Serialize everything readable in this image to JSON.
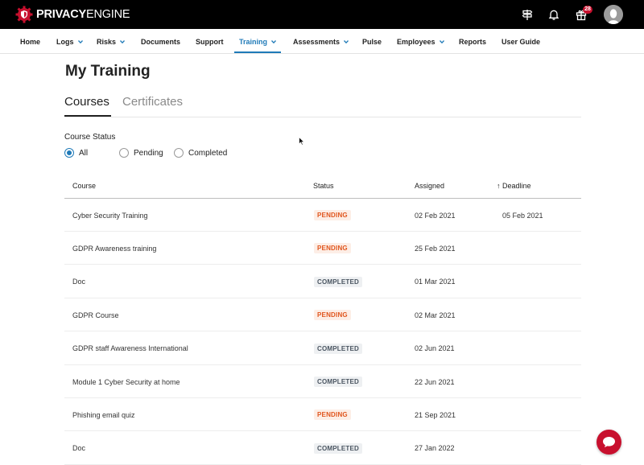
{
  "brand": {
    "name_bold": "PRIVACY",
    "name_light": "ENGINE",
    "accent": "#c8102e"
  },
  "header": {
    "gift_badge": "28"
  },
  "nav": {
    "items": [
      {
        "label": "Home"
      },
      {
        "label": "Logs"
      },
      {
        "label": "Risks"
      },
      {
        "label": "Documents"
      },
      {
        "label": "Support"
      },
      {
        "label": "Training"
      },
      {
        "label": "Assessments"
      },
      {
        "label": "Pulse"
      },
      {
        "label": "Employees"
      },
      {
        "label": "Reports"
      },
      {
        "label": "User Guide"
      }
    ],
    "active": "Training",
    "active_color": "#1f7ab8"
  },
  "page": {
    "title": "My Training",
    "tabs": [
      {
        "label": "Courses"
      },
      {
        "label": "Certificates"
      }
    ],
    "filter": {
      "label": "Course Status",
      "options": [
        {
          "label": "All"
        },
        {
          "label": "Pending"
        },
        {
          "label": "Completed"
        }
      ],
      "selected": "All"
    }
  },
  "table": {
    "columns": {
      "course": "Course",
      "status": "Status",
      "assigned": "Assigned",
      "deadline": "Deadline",
      "sort_indicator": "↑"
    },
    "rows": [
      {
        "course": "Cyber Security Training",
        "status": "PENDING",
        "assigned": "02 Feb 2021",
        "deadline": "05 Feb 2021"
      },
      {
        "course": "GDPR Awareness training",
        "status": "PENDING",
        "assigned": "25 Feb 2021",
        "deadline": ""
      },
      {
        "course": "Doc",
        "status": "COMPLETED",
        "assigned": "01 Mar 2021",
        "deadline": ""
      },
      {
        "course": "GDPR Course",
        "status": "PENDING",
        "assigned": "02 Mar 2021",
        "deadline": ""
      },
      {
        "course": "GDPR staff Awareness International",
        "status": "COMPLETED",
        "assigned": "02 Jun 2021",
        "deadline": ""
      },
      {
        "course": "Module 1 Cyber Security at home",
        "status": "COMPLETED",
        "assigned": "22 Jun 2021",
        "deadline": ""
      },
      {
        "course": "Phishing email quiz",
        "status": "PENDING",
        "assigned": "21 Sep 2021",
        "deadline": ""
      },
      {
        "course": "Doc",
        "status": "COMPLETED",
        "assigned": "27 Jan 2022",
        "deadline": ""
      }
    ]
  },
  "icons": {
    "logo": "gear-shield-icon",
    "signpost": "signpost-icon",
    "bell": "bell-icon",
    "gift": "gift-icon",
    "avatar": "user-avatar-icon",
    "chat": "chat-bubble-icon"
  }
}
